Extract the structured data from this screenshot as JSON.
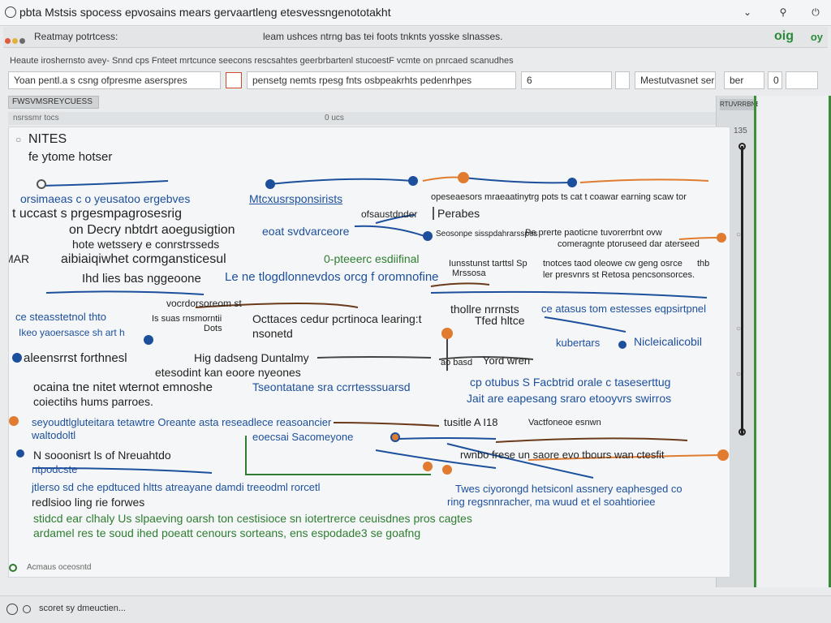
{
  "window": {
    "title": "pbta Mstsis spocess epvosains mears gervaartleng etesvessngenototakht",
    "controls": [
      "⌄",
      "⚲",
      "⏻"
    ]
  },
  "toolbar": {
    "breadcrumb": "Reatmay potrtcess:",
    "title": "leam ushces ntrng bas tei foots tnknts yosske slnasses.",
    "badge": "oig",
    "badge2": "oy"
  },
  "info_line": "Heaute iroshernsto avey- Snnd cps Fnteet mrtcunce seecons rescsahtes geerbrbartenl stucoestF vcmte on pnrcaed scanudhes",
  "inputs": {
    "field1": "Yoan pentl.a s csng ofpresme aserspres",
    "field2": "pensetg nemts rpesg fnts osbpeakrhts pedenrhpes",
    "field3": "6",
    "field4": "Mestutvasnet ser",
    "field5": "ber",
    "field6": "0"
  },
  "panel": {
    "header": "FWSVMSREYCUESS",
    "col_a": "nsrssmr tocs",
    "col_b": "0 ucs",
    "right_label": "RTUVRRBNE",
    "scroll_number": "135"
  },
  "canvas": {
    "title": "NITES",
    "subtitle": "fe ytome hotser",
    "footer": "Acmaus oceosntd"
  },
  "nodes": [
    {
      "id": "n1",
      "text": "orsimaeas c o yeusatoo ergebves",
      "color": "blue"
    },
    {
      "id": "n2",
      "text": "Mtcxusrsponsirists",
      "color": "blue"
    },
    {
      "id": "n3",
      "text": "t uccast s prgesmpagrosesrig",
      "color": "dark"
    },
    {
      "id": "n4",
      "text": "on Decry nbtdrt aoegusigtion",
      "color": "dark"
    },
    {
      "id": "n5",
      "text": "hote wetssery e conrstrsseds",
      "color": "dark"
    },
    {
      "id": "n6",
      "text": "eoat svdvarceore",
      "color": "blue"
    },
    {
      "id": "n7",
      "text": "ofsaustdnder",
      "color": "dark"
    },
    {
      "id": "n8",
      "text": "Perabes",
      "color": "dark"
    },
    {
      "id": "n9",
      "text": "opeseaesors mraeaatinytrg pots ts cat t coawar earning scaw tor",
      "color": "dark"
    },
    {
      "id": "n10",
      "text": "Seosonpe sisspdahrarsspes",
      "color": "dark"
    },
    {
      "id": "n11",
      "text": "Pe prerte paoticne tuvorerrbnt ovw",
      "color": "dark"
    },
    {
      "id": "n12",
      "text": "comeragnte ptoruseed dar aterseed",
      "color": "dark"
    },
    {
      "id": "n13",
      "text": "MAR",
      "color": "dark"
    },
    {
      "id": "n14",
      "text": "aibiaiqiwhet cormgansticesul",
      "color": "dark"
    },
    {
      "id": "n15",
      "text": "0-pteeerc esdiifinal",
      "color": "green"
    },
    {
      "id": "n16",
      "text": "Iunsstunst tarttsl Sp",
      "color": "dark"
    },
    {
      "id": "n17",
      "text": "tnotces taod oleowe cw geng osrce",
      "color": "dark"
    },
    {
      "id": "n18",
      "text": "thb",
      "color": "dark"
    },
    {
      "id": "n19",
      "text": "Ihd lies bas nggeoone",
      "color": "dark"
    },
    {
      "id": "n20",
      "text": "Le ne tlogdlonnevdos orcg f oromnofine",
      "color": "blue"
    },
    {
      "id": "n21",
      "text": "Mrssosa",
      "color": "dark"
    },
    {
      "id": "n22",
      "text": "ler presvnrs st Retosa pencsonsorces.",
      "color": "dark"
    },
    {
      "id": "n23",
      "text": "vocrdorsoreom st",
      "color": "dark"
    },
    {
      "id": "n24",
      "text": "thollre nrrnsts",
      "color": "dark"
    },
    {
      "id": "n25",
      "text": "ce atasus tom estesses eqpsirtpnel",
      "color": "blue"
    },
    {
      "id": "n26",
      "text": "ce steasstetnol thto",
      "color": "blue"
    },
    {
      "id": "n27",
      "text": "Is suas rnsmorntii",
      "color": "dark"
    },
    {
      "id": "n28",
      "text": "Octtaces cedur pcrtinoca learing:t",
      "color": "dark"
    },
    {
      "id": "n29",
      "text": "Tfed hltce",
      "color": "dark"
    },
    {
      "id": "n30",
      "text": "Ikeo yaoersasce sh art h",
      "color": "blue"
    },
    {
      "id": "n31",
      "text": "Dots",
      "color": "dark"
    },
    {
      "id": "n32",
      "text": "nsonetd",
      "color": "dark"
    },
    {
      "id": "n33",
      "text": "kubertars",
      "color": "blue"
    },
    {
      "id": "n34",
      "text": "Nicleicalicobil",
      "color": "blue"
    },
    {
      "id": "n35",
      "text": "aleensrrst forthnesl",
      "color": "dark"
    },
    {
      "id": "n36",
      "text": "Hig dadseng Duntalmy",
      "color": "dark"
    },
    {
      "id": "n37",
      "text": "ao basd",
      "color": "dark"
    },
    {
      "id": "n38",
      "text": "Yord wren",
      "color": "dark"
    },
    {
      "id": "n39",
      "text": "etesodint kan eoore nyeones",
      "color": "dark"
    },
    {
      "id": "n40",
      "text": "ocaina tne nitet wternot emnoshe",
      "color": "dark"
    },
    {
      "id": "n41",
      "text": "Tseontatane sra ccrrtesssuarsd",
      "color": "blue"
    },
    {
      "id": "n42",
      "text": "cp otubus S Facbtrid orale c taseserttug",
      "color": "blue"
    },
    {
      "id": "n43",
      "text": "coiectihs hums parroes.",
      "color": "dark"
    },
    {
      "id": "n44",
      "text": "Jait are eapesang sraro etooyvrs swirros",
      "color": "blue"
    },
    {
      "id": "n45",
      "text": "seyoudtlgluteitara tetawtre Oreante asta reseadlece reasoancier",
      "color": "blue"
    },
    {
      "id": "n46",
      "text": "tusitle A I18",
      "color": "dark"
    },
    {
      "id": "n47",
      "text": "Vactfoneoe esnwn",
      "color": "dark"
    },
    {
      "id": "n48",
      "text": "waltodoltl",
      "color": "blue"
    },
    {
      "id": "n49",
      "text": "eoecsai Sacomeyone",
      "color": "blue"
    },
    {
      "id": "n50",
      "text": "N sooonisrt ls of Nreuahtdo",
      "color": "dark"
    },
    {
      "id": "n51",
      "text": "rwnbo frese un saore evo tbours wan ctesfit",
      "color": "dark"
    },
    {
      "id": "n52",
      "text": "ntpodcste",
      "color": "blue"
    },
    {
      "id": "n53",
      "text": "jtlerso sd che epdtuced hltts atreayane damdi treeodml rorcetl",
      "color": "blue"
    },
    {
      "id": "n54",
      "text": "Twes ciyorongd hetsiconl assnery eaphesged co",
      "color": "blue"
    },
    {
      "id": "n55",
      "text": "redlsioo ling rie forwes",
      "color": "dark"
    },
    {
      "id": "n56",
      "text": "ring regsnnracher, ma wuud et el soahtioriee",
      "color": "blue"
    },
    {
      "id": "n57",
      "text": "stidcd ear clhaly Us slpaeving oarsh ton cestisioce sn iotertrerce ceuisdnes pros cagtes",
      "color": "green"
    },
    {
      "id": "n58",
      "text": "ardamel res te soud ihed poeatt cenours sorteans, ens espodade3 se goafng",
      "color": "green"
    }
  ],
  "status": {
    "text": "scoret sy dmeuctien..."
  },
  "colors": {
    "blue": "#1c4f9c",
    "green": "#2f7d32",
    "orange": "#e07b30",
    "dark": "#222222"
  }
}
